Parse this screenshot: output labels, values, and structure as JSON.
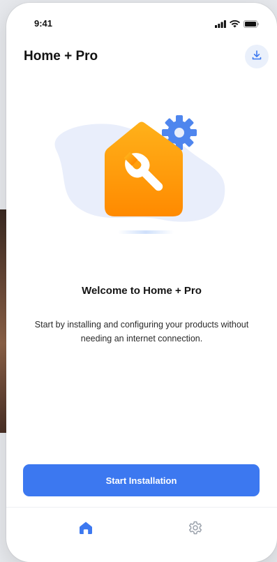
{
  "status_bar": {
    "time": "9:41"
  },
  "header": {
    "title": "Home + Pro",
    "download_icon": "download-icon"
  },
  "illustration": {
    "icon": "house-wrench-gear-illustration"
  },
  "welcome": {
    "title": "Welcome to Home + Pro",
    "description": "Start by installing and configuring your products without needing an internet connection."
  },
  "primary_action": {
    "label": "Start Installation"
  },
  "bottom_nav": {
    "items": [
      {
        "name": "home",
        "icon": "home-icon",
        "active": true
      },
      {
        "name": "settings",
        "icon": "gear-icon",
        "active": false
      }
    ]
  },
  "colors": {
    "accent": "#3c78f0",
    "house_orange_top": "#ffb11a",
    "house_orange_bottom": "#ff8a00",
    "gear_blue": "#4f86ee",
    "blob": "#e9eefb",
    "inactive_icon": "#9aa1ab"
  }
}
